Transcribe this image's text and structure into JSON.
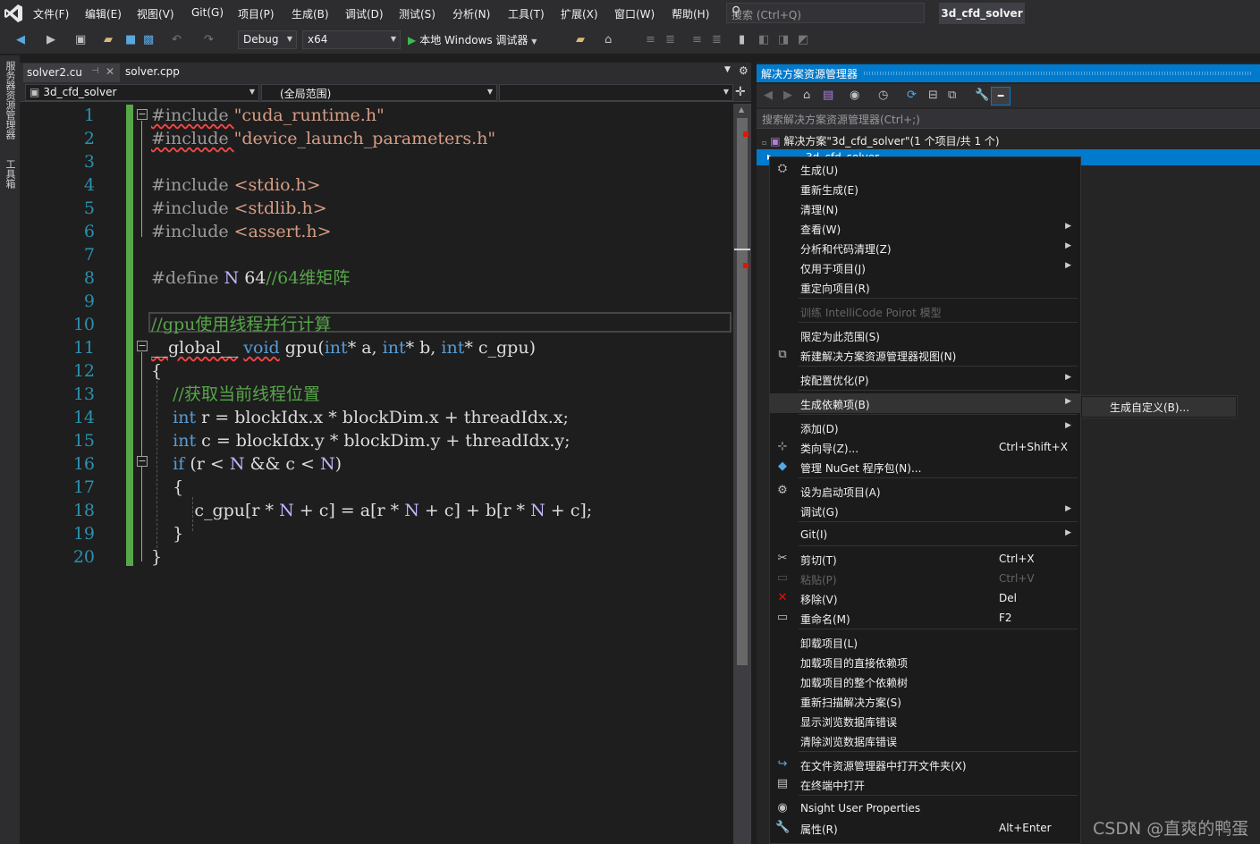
{
  "titlebar": {
    "menus": [
      "文件(F)",
      "编辑(E)",
      "视图(V)",
      "Git(G)",
      "项目(P)",
      "生成(B)",
      "调试(D)",
      "测试(S)",
      "分析(N)",
      "工具(T)",
      "扩展(X)",
      "窗口(W)",
      "帮助(H)"
    ],
    "search_placeholder": "搜索 (Ctrl+Q)",
    "solution_name": "3d_cfd_solver"
  },
  "toolbar": {
    "config": "Debug",
    "platform": "x64",
    "run_label": "本地 Windows 调试器"
  },
  "side_strip": {
    "server_explorer": "服务器资源管理器",
    "toolbox": "工具箱"
  },
  "tabs": [
    {
      "label": "solver2.cu",
      "active": true
    },
    {
      "label": "solver.cpp",
      "active": false
    }
  ],
  "navbar": {
    "project": "3d_cfd_solver",
    "scope": "(全局范围)"
  },
  "editor": {
    "line_numbers": [
      "1",
      "2",
      "3",
      "4",
      "5",
      "6",
      "7",
      "8",
      "9",
      "10",
      "11",
      "12",
      "13",
      "14",
      "15",
      "16",
      "17",
      "18",
      "19",
      "20"
    ],
    "lines": [
      [
        {
          "t": "#include ",
          "c": "grey",
          "sq": true
        },
        {
          "t": "\"cuda_runtime.h\"",
          "c": "str"
        }
      ],
      [
        {
          "t": "#include ",
          "c": "grey",
          "sq": true
        },
        {
          "t": "\"device_launch_parameters.h\"",
          "c": "str"
        }
      ],
      [],
      [
        {
          "t": "#include ",
          "c": "grey"
        },
        {
          "t": "<stdio.h>",
          "c": "str"
        }
      ],
      [
        {
          "t": "#include ",
          "c": "grey"
        },
        {
          "t": "<stdlib.h>",
          "c": "str"
        }
      ],
      [
        {
          "t": "#include ",
          "c": "grey"
        },
        {
          "t": "<assert.h>",
          "c": "str"
        }
      ],
      [],
      [
        {
          "t": "#define ",
          "c": "grey"
        },
        {
          "t": "N",
          "c": "mac"
        },
        {
          "t": " 64",
          "c": ""
        },
        {
          "t": "//64维矩阵",
          "c": "cm"
        }
      ],
      [],
      [
        {
          "t": "//gpu使用线程并行计算",
          "c": "cm"
        }
      ],
      [
        {
          "t": "__global__",
          "c": "",
          "sq": true
        },
        {
          "t": " ",
          "c": ""
        },
        {
          "t": "void",
          "c": "kw",
          "sq": true
        },
        {
          "t": " gpu(",
          "c": ""
        },
        {
          "t": "int",
          "c": "kw"
        },
        {
          "t": "* a, ",
          "c": ""
        },
        {
          "t": "int",
          "c": "kw"
        },
        {
          "t": "* b, ",
          "c": ""
        },
        {
          "t": "int",
          "c": "kw"
        },
        {
          "t": "* c_gpu)",
          "c": ""
        }
      ],
      [
        {
          "t": "{",
          "c": ""
        }
      ],
      [
        {
          "t": "    //获取当前线程位置",
          "c": "cm"
        }
      ],
      [
        {
          "t": "    ",
          "c": ""
        },
        {
          "t": "int",
          "c": "kw"
        },
        {
          "t": " r = blockIdx.x * blockDim.x + threadIdx.x;",
          "c": ""
        }
      ],
      [
        {
          "t": "    ",
          "c": ""
        },
        {
          "t": "int",
          "c": "kw"
        },
        {
          "t": " c = blockIdx.y * blockDim.y + threadIdx.y;",
          "c": ""
        }
      ],
      [
        {
          "t": "    ",
          "c": ""
        },
        {
          "t": "if",
          "c": "kw"
        },
        {
          "t": " (r < ",
          "c": ""
        },
        {
          "t": "N",
          "c": "mac"
        },
        {
          "t": " && c < ",
          "c": ""
        },
        {
          "t": "N",
          "c": "mac"
        },
        {
          "t": ")",
          "c": ""
        }
      ],
      [
        {
          "t": "    {",
          "c": ""
        }
      ],
      [
        {
          "t": "        c_gpu[r * ",
          "c": ""
        },
        {
          "t": "N",
          "c": "mac"
        },
        {
          "t": " + c] = a[r * ",
          "c": ""
        },
        {
          "t": "N",
          "c": "mac"
        },
        {
          "t": " + c] + b[r * ",
          "c": ""
        },
        {
          "t": "N",
          "c": "mac"
        },
        {
          "t": " + c];",
          "c": ""
        }
      ],
      [
        {
          "t": "    }",
          "c": ""
        }
      ],
      [
        {
          "t": "}",
          "c": ""
        }
      ]
    ]
  },
  "solution_explorer": {
    "title": "解决方案资源管理器",
    "search_placeholder": "搜索解决方案资源管理器(Ctrl+;)",
    "solution_node": "解决方案\"3d_cfd_solver\"(1 个项目/共 1 个)",
    "project_node": "3d_cfd_solver"
  },
  "context_menu": {
    "items": [
      {
        "label": "生成(U)",
        "icon": "build-icon"
      },
      {
        "label": "重新生成(E)"
      },
      {
        "label": "清理(N)"
      },
      {
        "label": "查看(W)",
        "submenu": true
      },
      {
        "label": "分析和代码清理(Z)",
        "submenu": true
      },
      {
        "label": "仅用于项目(J)",
        "submenu": true
      },
      {
        "label": "重定向项目(R)"
      },
      {
        "label": "训练 IntelliCode Poirot 模型",
        "disabled": true
      },
      {
        "label": "限定为此范围(S)"
      },
      {
        "label": "新建解决方案资源管理器视图(N)",
        "icon": "new-view-icon"
      },
      {
        "label": "按配置优化(P)",
        "submenu": true
      },
      {
        "label": "生成依赖项(B)",
        "submenu": true,
        "highlighted": true
      },
      {
        "label": "添加(D)",
        "submenu": true
      },
      {
        "label": "类向导(Z)...",
        "shortcut": "Ctrl+Shift+X",
        "icon": "class-wizard-icon"
      },
      {
        "label": "管理 NuGet 程序包(N)...",
        "icon": "nuget-icon"
      },
      {
        "label": "设为启动项目(A)",
        "icon": "gear-icon"
      },
      {
        "label": "调试(G)",
        "submenu": true
      },
      {
        "label": "Git(I)",
        "submenu": true
      },
      {
        "label": "剪切(T)",
        "shortcut": "Ctrl+X",
        "icon": "cut-icon"
      },
      {
        "label": "粘贴(P)",
        "shortcut": "Ctrl+V",
        "disabled": true,
        "icon": "paste-icon"
      },
      {
        "label": "移除(V)",
        "shortcut": "Del",
        "icon": "remove-icon"
      },
      {
        "label": "重命名(M)",
        "shortcut": "F2",
        "icon": "rename-icon"
      },
      {
        "label": "卸载项目(L)"
      },
      {
        "label": "加载项目的直接依赖项"
      },
      {
        "label": "加载项目的整个依赖树"
      },
      {
        "label": "重新扫描解决方案(S)"
      },
      {
        "label": "显示浏览数据库错误"
      },
      {
        "label": "清除浏览数据库错误"
      },
      {
        "label": "在文件资源管理器中打开文件夹(X)",
        "icon": "open-folder-icon"
      },
      {
        "label": "在终端中打开",
        "icon": "terminal-icon"
      },
      {
        "label": "Nsight User Properties",
        "icon": "nsight-icon"
      },
      {
        "label": "属性(R)",
        "shortcut": "Alt+Enter",
        "icon": "properties-icon"
      }
    ],
    "submenu_item": "生成自定义(B)..."
  },
  "watermark": "CSDN @直爽的鸭蛋",
  "colors": {
    "accent": "#007acc",
    "keyword": "#569cd6",
    "string": "#d69d85",
    "comment": "#57a64a",
    "macro": "#beb7ff",
    "line_number": "#2b91af"
  }
}
